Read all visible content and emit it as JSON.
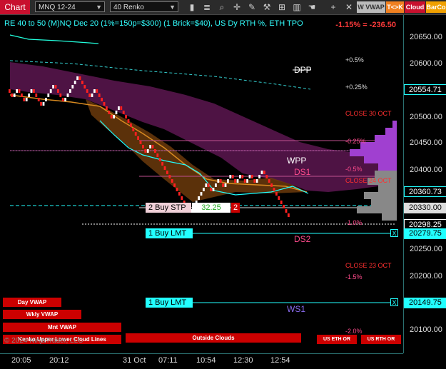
{
  "toolbar": {
    "chart_label": "Chart",
    "instrument": "MNQ 12-24",
    "bar_type": "40 Renko",
    "icons": [
      "bar-chart-icon",
      "list-icon",
      "magnifier-icon",
      "crosshair-icon",
      "pencil-icon",
      "tools-icon",
      "grid-icon",
      "bars-icon",
      "hand-icon",
      "plus-icon",
      "close-icon"
    ],
    "btn_wvwap": "W VWAP",
    "btn_tk": "T<>K",
    "btn_cloud": "Cloud",
    "btn_barco": "BarCo"
  },
  "chart": {
    "title": "RE 40 to 50 (M)NQ Dec 20 (1%=150p=$300) (1 Brick=$40), US Dy RTH %, ETH TPO",
    "pnl": "-1.15% = -236.50",
    "y_ticks": [
      "20650.00",
      "20600.00",
      "20500.00",
      "20450.00",
      "20400.00",
      "20250.00",
      "20200.00",
      "20100.00"
    ],
    "y_labels": {
      "cyan1": "20554.71",
      "cyan2": "20360.73",
      "white1": "20330.00",
      "white2": "20298.25",
      "cyan3": "20279.75",
      "cyan4": "20149.75"
    },
    "x_ticks": [
      "20:05",
      "20:12",
      "31 Oct",
      "07:11",
      "10:54",
      "12:30",
      "12:54"
    ],
    "levels": {
      "pct_plus05": "+0.5%",
      "pct_plus025": "+0.25%",
      "close30": "CLOSE 30 OCT",
      "pct_m025": "-0.25%",
      "pct_m05": "-0.5%",
      "close24": "CLOSE 24 OCT",
      "pct_m1": "-1.0%",
      "close23": "CLOSE 23 OCT",
      "pct_m15": "-1.5%",
      "pct_m2": "-2.0%",
      "dpp": "DPP",
      "wpp": "WPP",
      "ds1": "DS1",
      "ds2": "DS2",
      "ws1": "WS1"
    },
    "orders": {
      "stop_label": "2 Buy STP",
      "stop_price": "32.25",
      "stop_qty": "2",
      "limit1": "1 Buy LMT",
      "limit2": "1 Buy LMT",
      "cancel": "X"
    },
    "legend_buttons": [
      "Day VWAP",
      "Wkly VWAP",
      "Mnt VWAP",
      "Kenko Upper Lower Cloud Lines"
    ],
    "bottom_buttons": [
      "Outside Clouds",
      "US ETH OR",
      "US RTH OR"
    ],
    "copyright": "© 2024 NinjaTrader, LLC",
    "colors": {
      "accent_cyan": "#00ffff",
      "bull_brick": "#ffffff",
      "bear_brick": "#ff2020",
      "cloud_purple": "#7a1f6a",
      "cloud_orange": "#7a4a10"
    }
  }
}
